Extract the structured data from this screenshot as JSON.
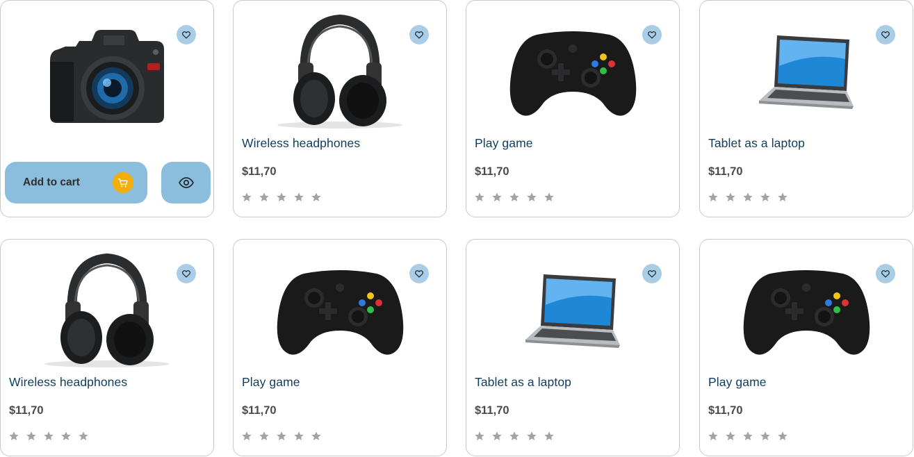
{
  "products": [
    {
      "type": "camera",
      "title": "",
      "price": "",
      "hover": true
    },
    {
      "type": "headphones",
      "title": "Wireless headphones",
      "price": "$11,70"
    },
    {
      "type": "gamepad",
      "title": "Play game",
      "price": "$11,70"
    },
    {
      "type": "laptop",
      "title": "Tablet as a laptop",
      "price": "$11,70"
    },
    {
      "type": "headphones",
      "title": "Wireless headphones",
      "price": "$11,70"
    },
    {
      "type": "gamepad",
      "title": "Play game",
      "price": "$11,70"
    },
    {
      "type": "laptop",
      "title": "Tablet as a laptop",
      "price": "$11,70"
    },
    {
      "type": "gamepad",
      "title": "Play game",
      "price": "$11,70"
    }
  ],
  "hover_card": {
    "add_to_cart_label": "Add to cart",
    "cart_icon": "cart-icon",
    "view_icon": "eye-icon"
  },
  "rating": {
    "max_stars": 5,
    "filled": 0
  },
  "colors": {
    "title": "#0f3d5e",
    "price": "#4a4a4a",
    "star": "#a3a3a3",
    "wish_bg": "#a9cde6",
    "button_bg": "#8bbedd",
    "cart_circle": "#f5ad0a"
  }
}
